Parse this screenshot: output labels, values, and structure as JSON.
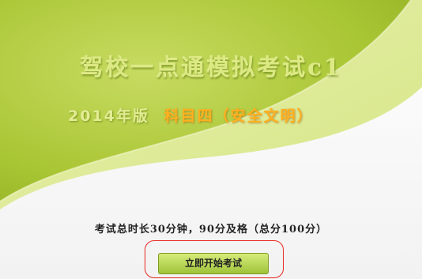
{
  "banner": {
    "title": "驾校一点通模拟考试c1",
    "edition": "2014年版",
    "subject": "科目四（安全文明）"
  },
  "exam": {
    "info": "考试总时长30分钟，90分及格（总分100分）"
  },
  "actions": {
    "start_label": "立即开始考试"
  },
  "colors": {
    "banner_green_dark": "#a3c12c",
    "banner_green_light": "#dbe88c",
    "subject_orange": "#ffb020",
    "highlight_red": "#e8271e"
  }
}
